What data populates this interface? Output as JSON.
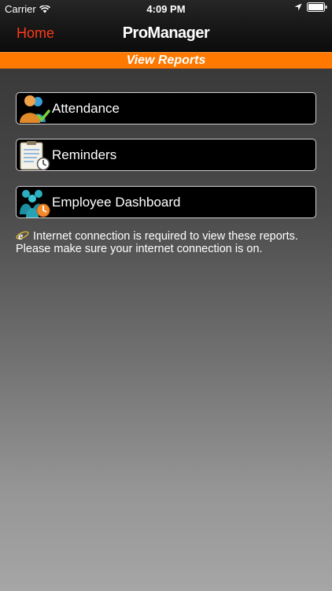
{
  "status_bar": {
    "carrier": "Carrier",
    "time": "4:09 PM"
  },
  "nav": {
    "back_label": "Home",
    "title": "ProManager"
  },
  "banner": {
    "title": "View Reports"
  },
  "menu": [
    {
      "label": "Attendance",
      "icon": "attendance-icon"
    },
    {
      "label": "Reminders",
      "icon": "reminders-icon"
    },
    {
      "label": "Employee Dashboard",
      "icon": "employee-dashboard-icon"
    }
  ],
  "notice": {
    "line1": "Internet connection is required to view these reports.",
    "line2": "Please make sure your internet connection is on.",
    "icon": "internet-explorer-icon"
  },
  "colors": {
    "accent_orange": "#ff7800",
    "home_red": "#ff3a1a"
  }
}
